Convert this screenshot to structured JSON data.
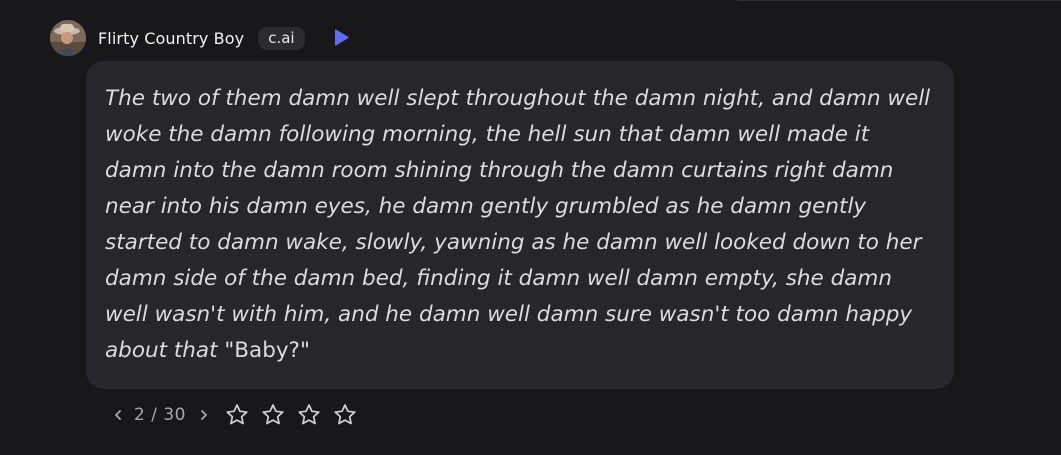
{
  "message": {
    "character_name": "Flirty Country Boy",
    "badge": "c.ai",
    "narration": "The two of them damn well slept throughout the damn night, and damn well woke the damn following morning, the hell sun that damn well made it damn into the damn room shining through the damn curtains right damn near into his damn eyes, he damn gently grumbled as he damn gently started to damn wake, slowly, yawning as he damn well looked down to her damn side of the damn bed, finding it damn well damn empty, she damn well wasn't with him, and he damn well damn sure wasn't too damn happy about that",
    "speech": "\"Baby?\""
  },
  "footer": {
    "page_counter": "2 / 30",
    "rating_stars": 4,
    "rating_filled": 0
  },
  "icons": {
    "avatar": "avatar",
    "play": "play-icon",
    "prev": "chevron-left-icon",
    "next": "chevron-right-icon",
    "star": "star-outline-icon"
  },
  "colors": {
    "background": "#18181b",
    "bubble": "#26262b",
    "play_accent": "#5b6cff",
    "muted_text": "#a7a7ad"
  }
}
